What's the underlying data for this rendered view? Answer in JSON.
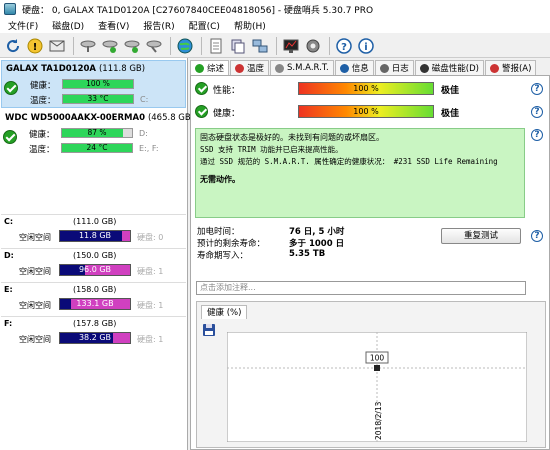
{
  "window": {
    "title": "硬盘：  0, GALAX TA1D0120A [C27607840CEE04818056]  -  硬盘哨兵 5.30.7 PRO"
  },
  "menu": [
    "文件(F)",
    "磁盘(D)",
    "查看(V)",
    "报告(R)",
    "配置(C)",
    "帮助(H)"
  ],
  "toolbar": {
    "icons": [
      "refresh-icon",
      "warning-icon",
      "mail-icon",
      "disk-settings-icon",
      "disk-tools-icon",
      "disk-test-icon",
      "disk-config-icon",
      "globe-icon",
      "document-icon",
      "copy-icon",
      "network-icon",
      "monitor-icon",
      "gear-icon",
      "help-icon",
      "info-icon"
    ]
  },
  "disks": [
    {
      "name": "GALAX TA1D0120A",
      "size": "(111.8 GB)",
      "health_label": "健康：",
      "health_value": "100 %",
      "health_fraction": 1.0,
      "temp_label": "温度：",
      "temp_value": "33 °C",
      "drives": "C:",
      "selected": true
    },
    {
      "name": "WDC WD5000AAKX-00ERMA0",
      "size": "(465.8 GB)",
      "health_label": "健康：",
      "health_value": "87 %",
      "health_fraction": 0.87,
      "temp_label": "温度：",
      "temp_value": "24 °C",
      "drives_health": "D:",
      "drives": "E:, F:",
      "selected": false
    }
  ],
  "volumes": [
    {
      "letter": "C:",
      "size": "(111.0 GB)",
      "free_label": "空闲空间",
      "free_value": "11.8 GB",
      "used_fraction": 0.11,
      "hint": "硬盘: 0"
    },
    {
      "letter": "D:",
      "size": "(150.0 GB)",
      "free_label": "空闲空间",
      "free_value": "96.0 GB",
      "used_fraction": 0.64,
      "hint": "硬盘: 1"
    },
    {
      "letter": "E:",
      "size": "(158.0 GB)",
      "free_label": "空闲空间",
      "free_value": "133.1 GB",
      "used_fraction": 0.84,
      "hint": "硬盘: 1"
    },
    {
      "letter": "F:",
      "size": "(157.8 GB)",
      "free_label": "空闲空间",
      "free_value": "38.2 GB",
      "used_fraction": 0.24,
      "hint": "硬盘: 1"
    }
  ],
  "tabs": [
    {
      "label": "综述",
      "icon": "overview-icon",
      "color": "#25a025"
    },
    {
      "label": "温度",
      "icon": "thermometer-icon",
      "color": "#c33"
    },
    {
      "label": "S.M.A.R.T.",
      "icon": "smart-icon",
      "color": "#888"
    },
    {
      "label": "信息",
      "icon": "info-icon",
      "color": "#1e5fa6"
    },
    {
      "label": "日志",
      "icon": "log-icon",
      "color": "#666"
    },
    {
      "label": "磁盘性能(D)",
      "icon": "performance-icon",
      "color": "#333"
    },
    {
      "label": "警报(A)",
      "icon": "alert-icon",
      "color": "#c33"
    }
  ],
  "overview": {
    "performance_label": "性能：",
    "performance_value": "100 %",
    "performance_grade": "极佳",
    "health_label": "健康：",
    "health_value": "100 %",
    "health_grade": "极佳",
    "message_lines": [
      "固态硬盘状态是极好的。未找到有问题的或坏扇区。",
      "SSD 支持 TRIM 功能并已启来提高性能。",
      "通过 SSD 规范的 S.M.A.R.T. 属性确定的健康状况：   #231 SSD Life Remaining"
    ],
    "action": "无需动作。",
    "power_on_label": "加电时间：",
    "power_on_value": "76 日, 5 小时",
    "remaining_label": "预计的剩余寿命：",
    "remaining_value": "多于 1000 日",
    "written_label": "寿命期写入：",
    "written_value": "5.35 TB",
    "retest_button": "重复测试",
    "note_placeholder": "点击添加注释..."
  },
  "chart_data": {
    "type": "line",
    "title": "健康 (%)",
    "x": [
      "2018/2/13"
    ],
    "series": [
      {
        "values": [
          100
        ]
      }
    ],
    "point_labels": [
      "100"
    ],
    "ytick": "100",
    "grid": true
  }
}
